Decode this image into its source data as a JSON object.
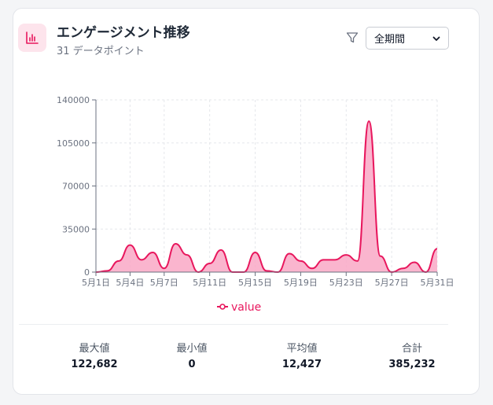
{
  "header": {
    "title": "エンゲージメント推移",
    "subtitle": "31 データポイント",
    "period_select": {
      "selected": "全期間"
    }
  },
  "stats": [
    {
      "label": "最大値",
      "value": "122,682"
    },
    {
      "label": "最小値",
      "value": "0"
    },
    {
      "label": "平均値",
      "value": "12,427"
    },
    {
      "label": "合計",
      "value": "385,232"
    }
  ],
  "colors": {
    "accent": "#e8175d",
    "area_fill": "#f9a8c6",
    "icon_bg": "#fde4ec"
  },
  "chart_data": {
    "type": "area",
    "x": [
      "5月1日",
      "5月2日",
      "5月3日",
      "5月4日",
      "5月5日",
      "5月6日",
      "5月7日",
      "5月8日",
      "5月9日",
      "5月10日",
      "5月11日",
      "5月12日",
      "5月13日",
      "5月14日",
      "5月15日",
      "5月16日",
      "5月17日",
      "5月18日",
      "5月19日",
      "5月20日",
      "5月21日",
      "5月22日",
      "5月23日",
      "5月24日",
      "5月25日",
      "5月26日",
      "5月27日",
      "5月28日",
      "5月29日",
      "5月30日",
      "5月31日"
    ],
    "xticks": [
      "5月1日",
      "5月4日",
      "5月7日",
      "5月11日",
      "5月15日",
      "5月19日",
      "5月23日",
      "5月27日",
      "5月31日"
    ],
    "series": [
      {
        "name": "value",
        "values": [
          0,
          1000,
          9000,
          22000,
          10000,
          16000,
          3000,
          23000,
          14000,
          0,
          7000,
          18000,
          0,
          0,
          16000,
          1000,
          0,
          15000,
          9000,
          3000,
          10000,
          10000,
          14000,
          9000,
          122682,
          13000,
          0,
          3000,
          8000,
          0,
          19000
        ]
      }
    ],
    "ylim": [
      0,
      140000
    ],
    "yticks": [
      0,
      35000,
      70000,
      105000,
      140000
    ],
    "grid": true,
    "legend": "bottom"
  }
}
